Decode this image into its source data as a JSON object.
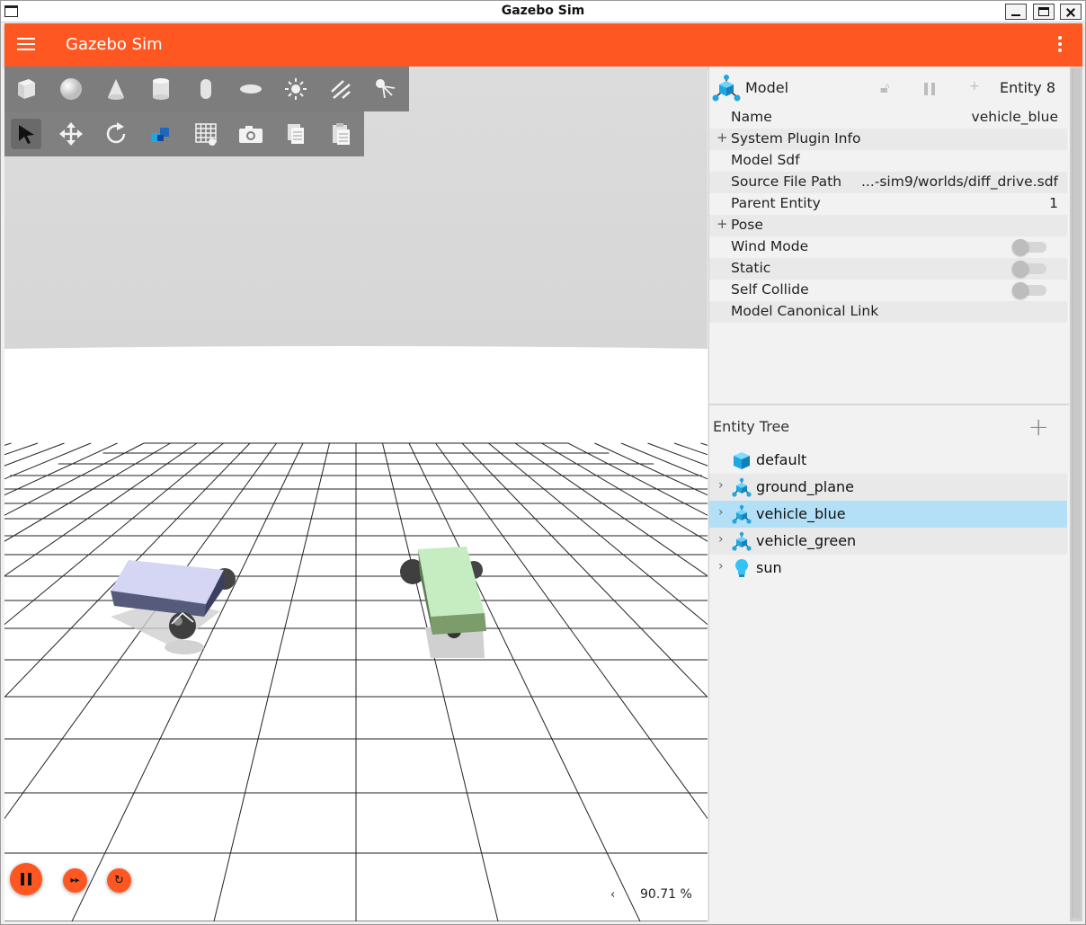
{
  "window": {
    "title": "Gazebo Sim"
  },
  "appbar": {
    "title": "Gazebo Sim",
    "menu_icon": "hamburger-menu-icon",
    "more_icon": "kebab-menu-icon"
  },
  "toolbar": {
    "shapes": [
      "box-icon",
      "sphere-icon",
      "cone-icon",
      "cylinder-icon",
      "capsule-icon",
      "ellipsoid-icon",
      "point-light-icon",
      "directional-light-icon",
      "spot-light-icon"
    ],
    "tools": [
      "select-icon",
      "translate-icon",
      "rotate-icon",
      "transform-control-icon",
      "grid-snap-icon",
      "screenshot-icon",
      "copy-icon",
      "paste-icon"
    ]
  },
  "playback": {
    "step_glyph": "▸▸",
    "reset_glyph": "↻",
    "rtf_arrow": "‹",
    "real_time_factor": "90.71 %"
  },
  "component_inspector": {
    "type_label": "Model",
    "entity_label": "Entity 8",
    "rows": [
      {
        "key": "Name",
        "value": "vehicle_blue",
        "expandable": false
      },
      {
        "key": "System Plugin Info",
        "value": "",
        "expandable": true
      },
      {
        "key": "Model Sdf",
        "value": "",
        "expandable": false
      },
      {
        "key": "Source File Path",
        "value": "...-sim9/worlds/diff_drive.sdf",
        "expandable": false
      },
      {
        "key": "Parent Entity",
        "value": "1",
        "expandable": false
      },
      {
        "key": "Pose",
        "value": "",
        "expandable": true
      },
      {
        "key": "Wind Mode",
        "value": "",
        "toggle": false
      },
      {
        "key": "Static",
        "value": "",
        "toggle": false
      },
      {
        "key": "Self Collide",
        "value": "",
        "toggle": false
      },
      {
        "key": "Model Canonical Link",
        "value": "",
        "expandable": false
      }
    ]
  },
  "entity_tree": {
    "title": "Entity Tree",
    "add_glyph": "+",
    "expand_glyph": "+",
    "chevron_glyph": "›",
    "nodes": [
      {
        "label": "default",
        "icon": "world-cube-icon",
        "expandable": false,
        "selected": false
      },
      {
        "label": "ground_plane",
        "icon": "model-icon",
        "expandable": true,
        "selected": false
      },
      {
        "label": "vehicle_blue",
        "icon": "model-icon",
        "expandable": true,
        "selected": true
      },
      {
        "label": "vehicle_green",
        "icon": "model-icon",
        "expandable": true,
        "selected": false
      },
      {
        "label": "sun",
        "icon": "light-bulb-icon",
        "expandable": true,
        "selected": false
      }
    ]
  },
  "colors": {
    "accent": "#ff5722",
    "selected_row": "#b3e0f7",
    "icon_blue": "#1ea7e1"
  }
}
